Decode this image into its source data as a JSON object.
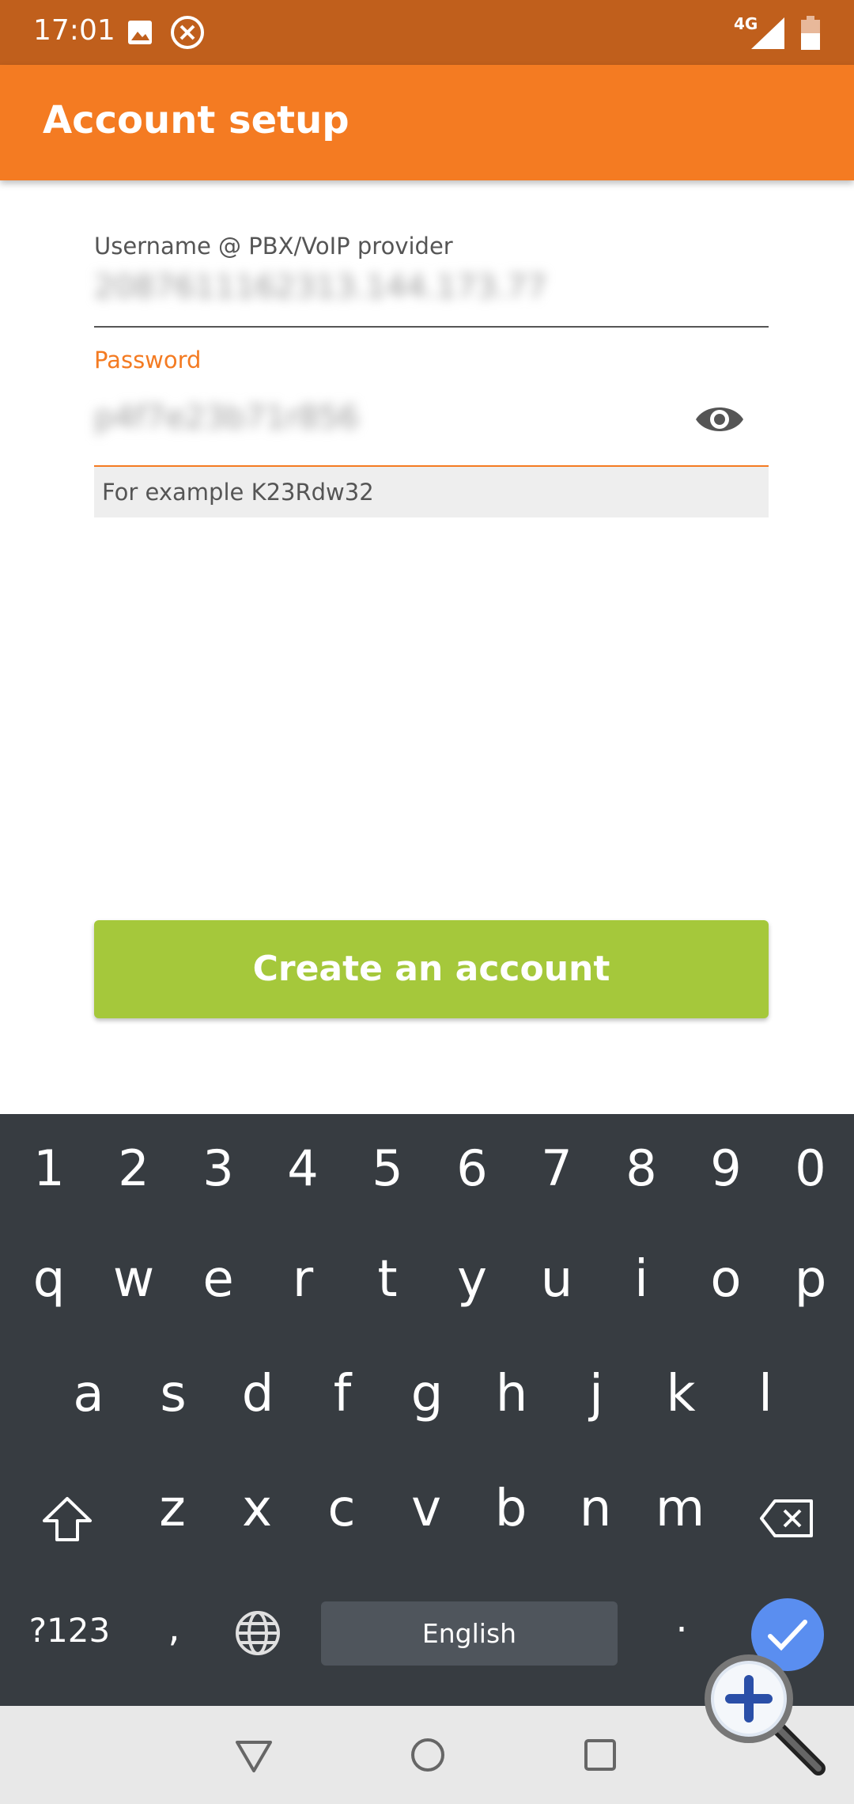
{
  "status_bar": {
    "time": "17:01",
    "network": "4G",
    "icons": [
      "image-icon",
      "cancel-circle-icon",
      "signal-icon",
      "battery-icon"
    ]
  },
  "app_bar": {
    "title": "Account setup"
  },
  "form": {
    "username": {
      "label": "Username @ PBX/VoIP provider",
      "value": "2087611162313.144.173.77"
    },
    "password": {
      "label": "Password",
      "value": "p4f7e23b71r856",
      "hint": "For example K23Rdw32"
    },
    "submit_label": "Create an account"
  },
  "keyboard": {
    "row_numbers": [
      "1",
      "2",
      "3",
      "4",
      "5",
      "6",
      "7",
      "8",
      "9",
      "0"
    ],
    "row1": [
      "q",
      "w",
      "e",
      "r",
      "t",
      "y",
      "u",
      "i",
      "o",
      "p"
    ],
    "row2": [
      "a",
      "s",
      "d",
      "f",
      "g",
      "h",
      "j",
      "k",
      "l"
    ],
    "row3": [
      "z",
      "x",
      "c",
      "v",
      "b",
      "n",
      "m"
    ],
    "symbols_label": "?123",
    "comma_label": ",",
    "period_label": ".",
    "space_label": "English"
  },
  "colors": {
    "status_bar": "#c05f1c",
    "app_bar": "#f47b22",
    "accent": "#f47b22",
    "button": "#a5c83b",
    "keyboard_bg": "#373c41",
    "enter_key": "#5a8ef0"
  }
}
